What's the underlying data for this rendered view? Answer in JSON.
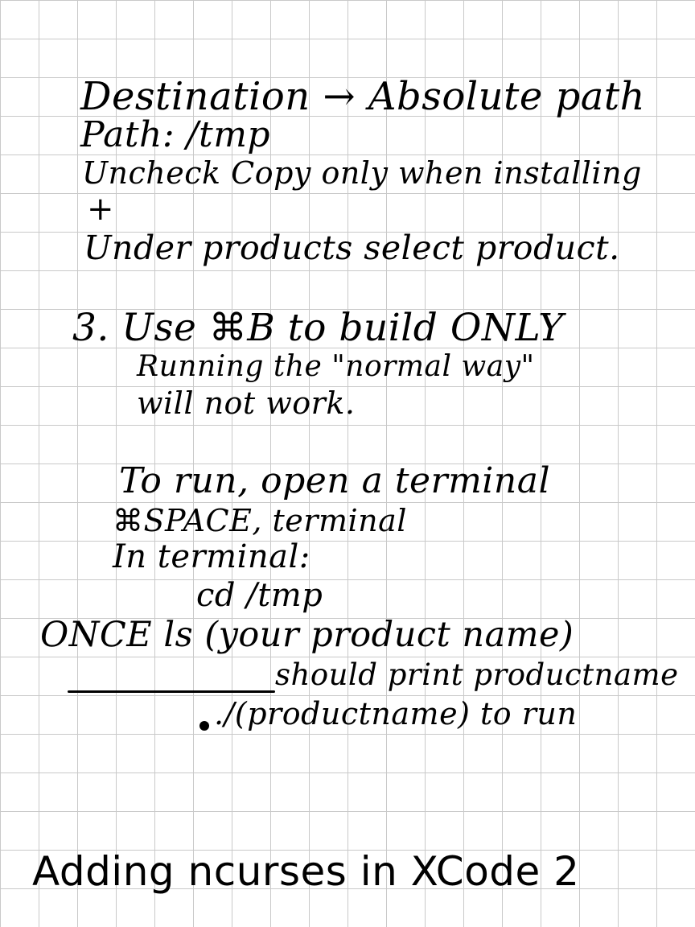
{
  "notes": {
    "line1": "Destination → Absolute path",
    "line2": "Path: /tmp",
    "line3": "Uncheck   Copy only when installing",
    "line4": "+",
    "line5": "Under products select product.",
    "line6": "3. Use ⌘B to build ONLY",
    "line7": "Running the \"normal way\"",
    "line8": "will not work.",
    "line9": "To run, open a terminal",
    "line10": "⌘SPACE, terminal",
    "line11": "In terminal:",
    "line12": "cd /tmp",
    "line13": "ONCE  ls  (your product name)",
    "line14": "should print productname",
    "line15": "./(productname)  to run",
    "title": "Adding ncurses in XCode 2"
  }
}
